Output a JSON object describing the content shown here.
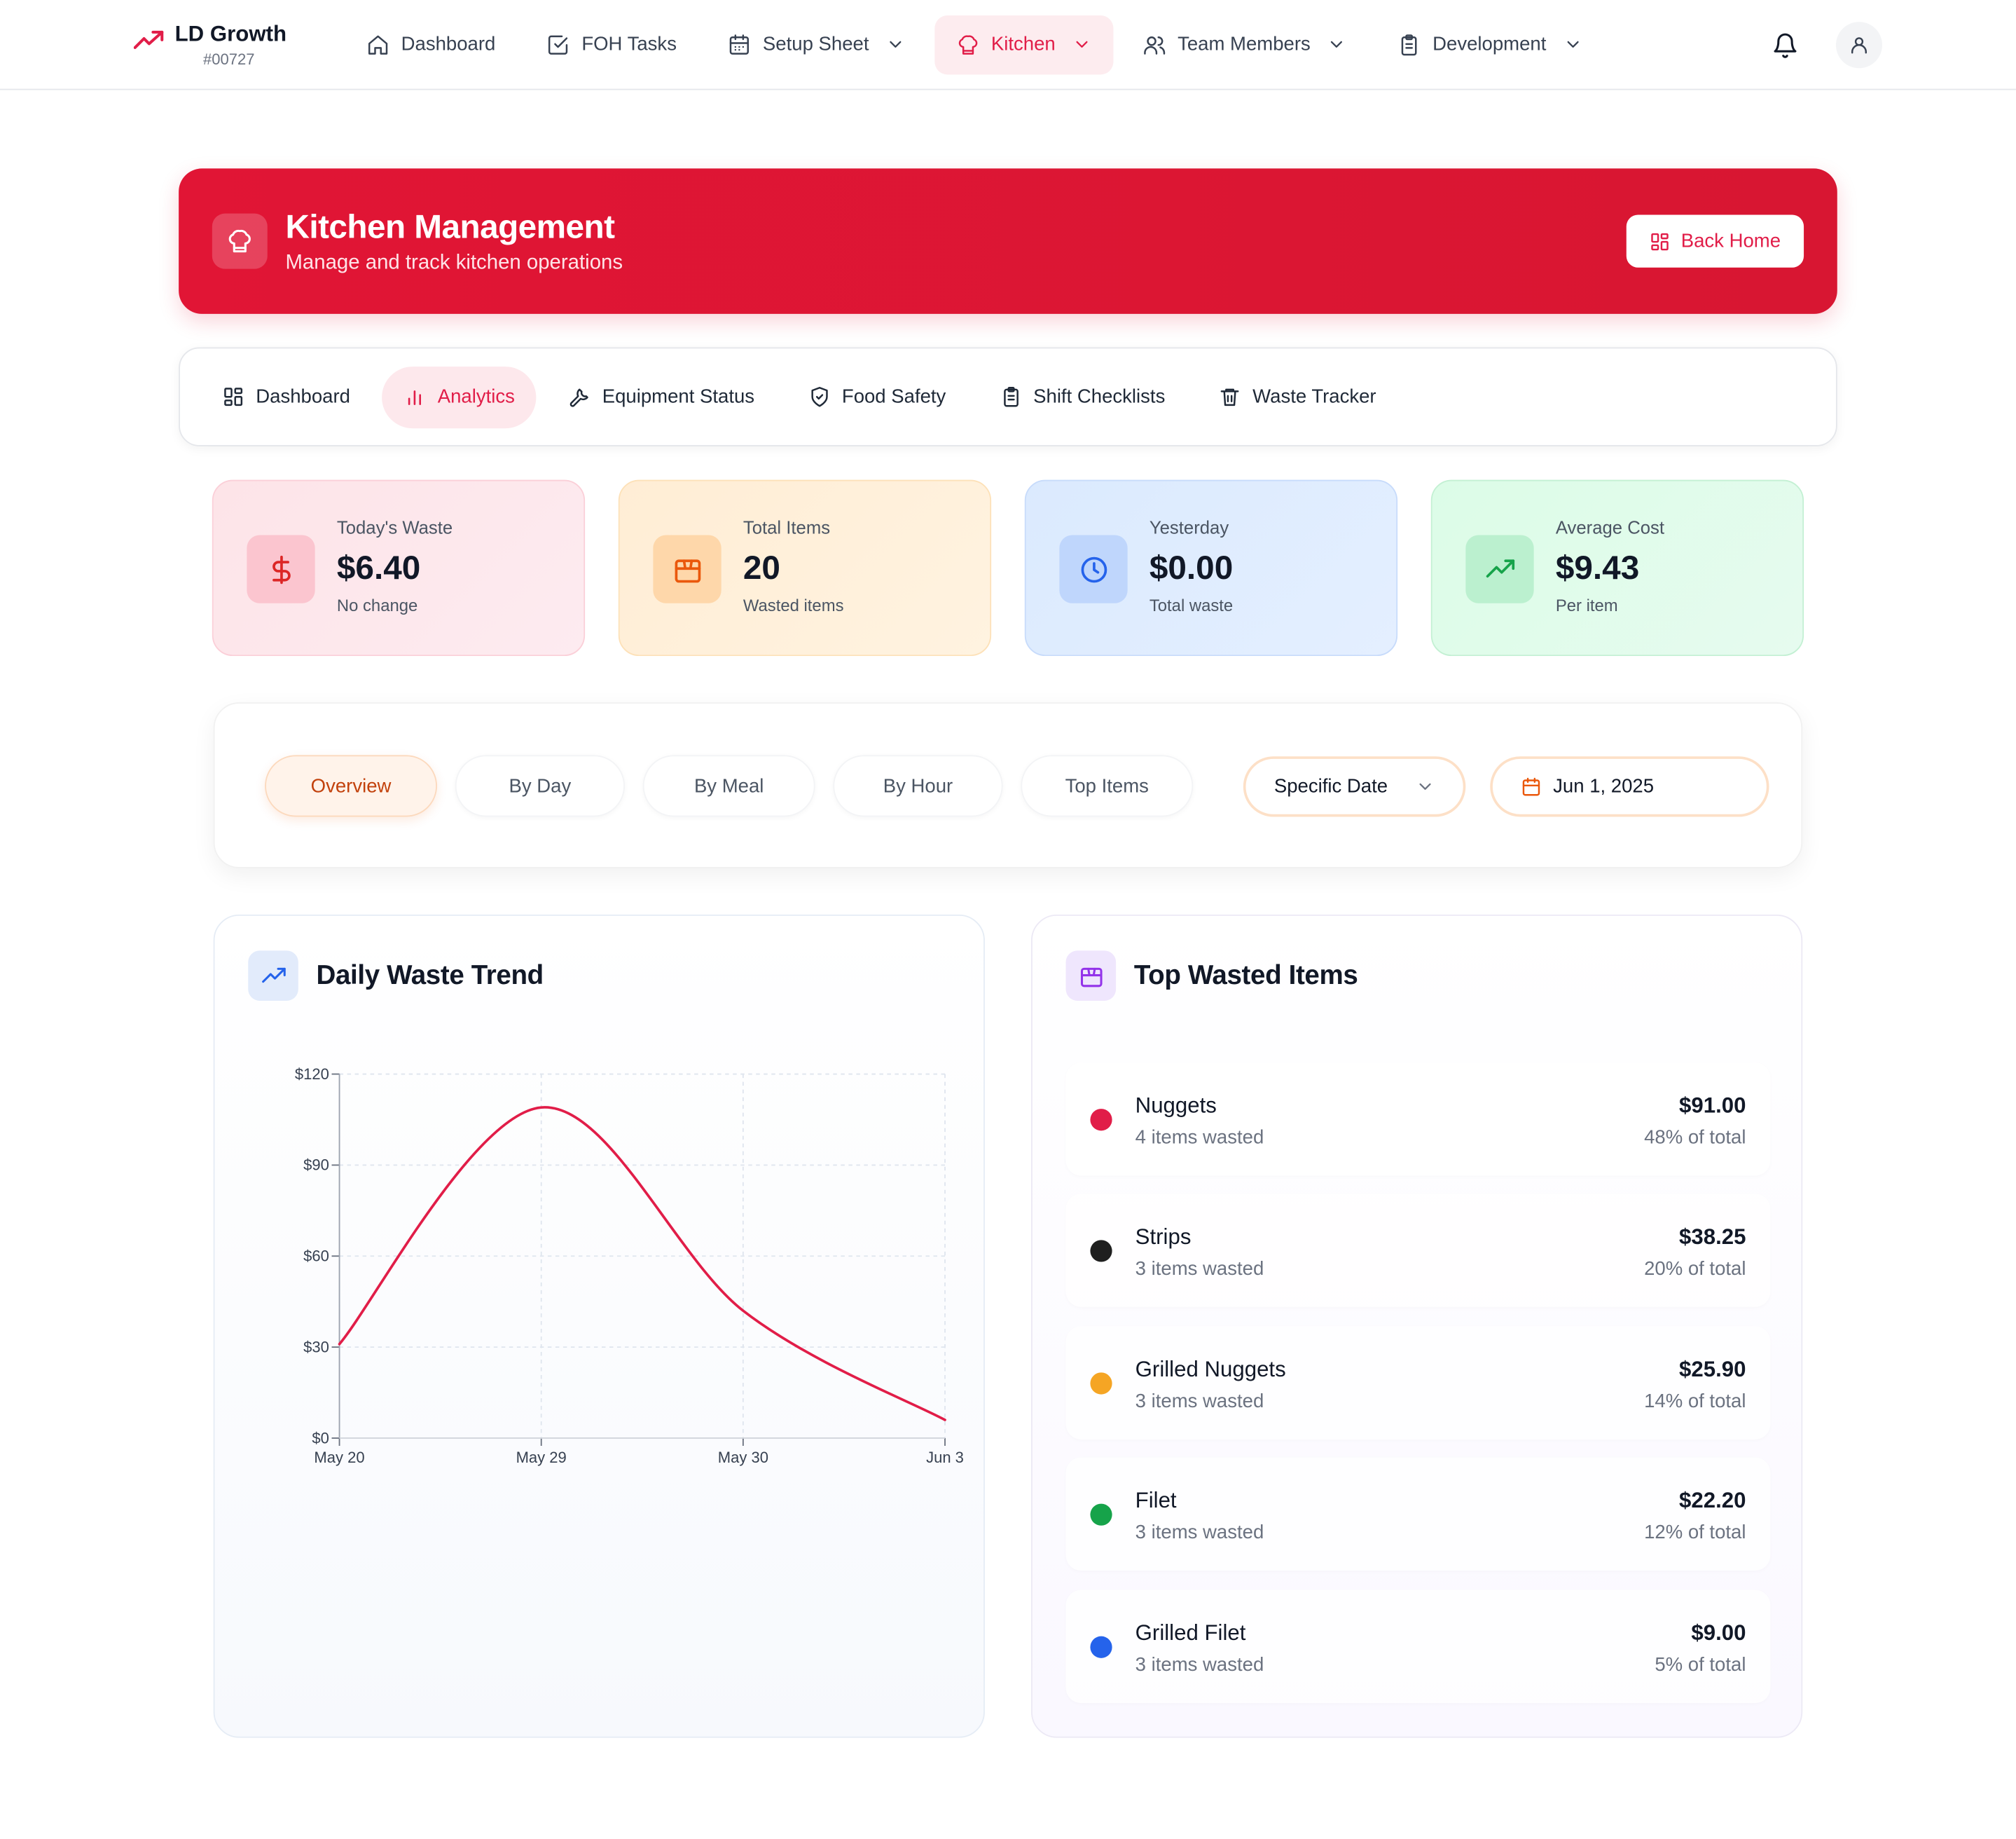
{
  "brand": {
    "name": "LD Growth",
    "id": "#00727"
  },
  "nav": {
    "items": [
      {
        "label": "Dashboard",
        "icon": "home-icon"
      },
      {
        "label": "FOH Tasks",
        "icon": "checkbox-icon"
      },
      {
        "label": "Setup Sheet",
        "icon": "calendar-icon"
      },
      {
        "label": "Kitchen",
        "icon": "chef-hat-icon",
        "active": true
      },
      {
        "label": "Team Members",
        "icon": "users-icon"
      },
      {
        "label": "Development",
        "icon": "clipboard-icon"
      }
    ]
  },
  "hero": {
    "title": "Kitchen Management",
    "subtitle": "Manage and track kitchen operations",
    "back_label": "Back Home"
  },
  "tabs": [
    {
      "label": "Dashboard",
      "icon": "grid-icon"
    },
    {
      "label": "Analytics",
      "icon": "bar-chart-icon",
      "active": true
    },
    {
      "label": "Equipment Status",
      "icon": "wrench-icon"
    },
    {
      "label": "Food Safety",
      "icon": "shield-icon"
    },
    {
      "label": "Shift Checklists",
      "icon": "clipboard-icon"
    },
    {
      "label": "Waste Tracker",
      "icon": "trash-icon"
    }
  ],
  "stats": [
    {
      "label": "Today's Waste",
      "value": "$6.40",
      "note": "No change",
      "icon": "dollar-icon"
    },
    {
      "label": "Total Items",
      "value": "20",
      "note": "Wasted items",
      "icon": "package-icon"
    },
    {
      "label": "Yesterday",
      "value": "$0.00",
      "note": "Total waste",
      "icon": "clock-icon"
    },
    {
      "label": "Average Cost",
      "value": "$9.43",
      "note": "Per item",
      "icon": "trending-up-icon"
    }
  ],
  "filters": {
    "segments": [
      "Overview",
      "By Day",
      "By Meal",
      "By Hour",
      "Top Items"
    ],
    "active_segment": "Overview",
    "mode": "Specific Date",
    "date": "Jun 1, 2025"
  },
  "trend_card": {
    "title": "Daily Waste Trend"
  },
  "chart_data": {
    "type": "line",
    "title": "Daily Waste Trend",
    "x": [
      "May 20",
      "May 29",
      "May 30",
      "Jun 3"
    ],
    "series": [
      {
        "values": [
          31,
          109,
          42,
          6
        ],
        "color": "#e11d48"
      }
    ],
    "yticks": [
      "$0",
      "$30",
      "$60",
      "$90",
      "$120"
    ],
    "ylim": [
      0,
      120
    ],
    "grid": true,
    "curve": "smooth"
  },
  "top_card": {
    "title": "Top Wasted Items",
    "items": [
      {
        "name": "Nuggets",
        "sub": "4 items wasted",
        "amount": "$91.00",
        "pct": "48% of total",
        "color": "#e11d48"
      },
      {
        "name": "Strips",
        "sub": "3 items wasted",
        "amount": "$38.25",
        "pct": "20% of total",
        "color": "#1f1f1f"
      },
      {
        "name": "Grilled Nuggets",
        "sub": "3 items wasted",
        "amount": "$25.90",
        "pct": "14% of total",
        "color": "#f5a524"
      },
      {
        "name": "Filet",
        "sub": "3 items wasted",
        "amount": "$22.20",
        "pct": "12% of total",
        "color": "#16a34a"
      },
      {
        "name": "Grilled Filet",
        "sub": "3 items wasted",
        "amount": "$9.00",
        "pct": "5% of total",
        "color": "#2563eb"
      }
    ]
  }
}
